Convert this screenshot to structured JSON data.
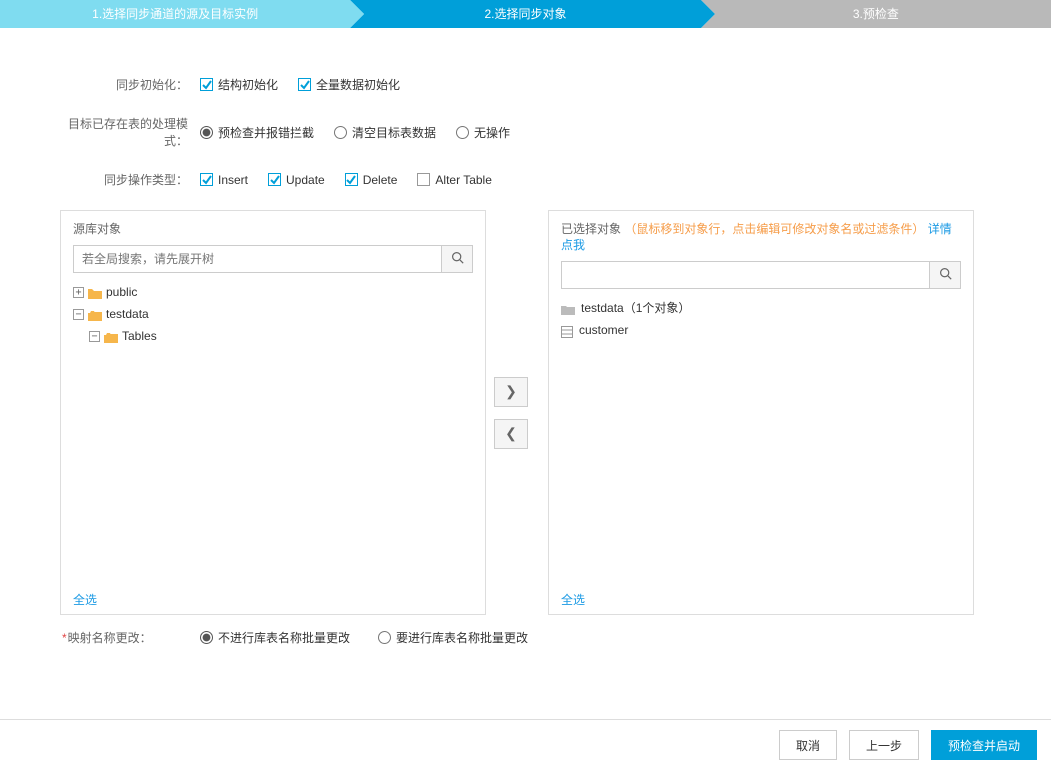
{
  "steps": {
    "s1": "1.选择同步通道的源及目标实例",
    "s2": "2.选择同步对象",
    "s3": "3.预检查"
  },
  "form": {
    "row_init_label": "同步初始化：",
    "init_struct": "结构初始化",
    "init_full": "全量数据初始化",
    "row_mode_label": "目标已存在表的处理模式：",
    "mode_precheck": "预检查并报错拦截",
    "mode_clear": "清空目标表数据",
    "mode_noop": "无操作",
    "row_ops_label": "同步操作类型：",
    "op_insert": "Insert",
    "op_update": "Update",
    "op_delete": "Delete",
    "op_alter": "Alter Table"
  },
  "source_panel": {
    "title": "源库对象",
    "search_placeholder": "若全局搜索，请先展开树",
    "tree": {
      "n1": "public",
      "n2": "testdata",
      "n3": "Tables"
    },
    "select_all": "全选"
  },
  "target_panel": {
    "title_strong": "已选择对象",
    "title_hint": "（鼠标移到对象行，点击编辑可修改对象名或过滤条件）",
    "title_link": "详情点我",
    "tree": {
      "n1": "testdata（1个对象）",
      "n2": "customer"
    },
    "select_all": "全选"
  },
  "mapping": {
    "label": "映射名称更改：",
    "opt_no": "不进行库表名称批量更改",
    "opt_yes": "要进行库表名称批量更改"
  },
  "footer": {
    "cancel": "取消",
    "prev": "上一步",
    "next": "预检查并启动"
  }
}
